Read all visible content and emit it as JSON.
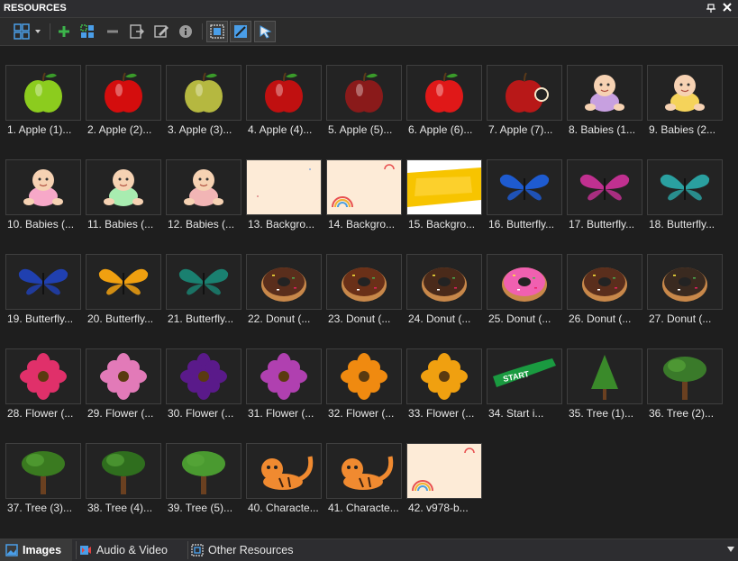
{
  "panel": {
    "title": "RESOURCES"
  },
  "toolbar": {
    "buttons": [
      "view-mode",
      "add",
      "add-multiple",
      "remove",
      "import",
      "edit",
      "info",
      "fit",
      "select-region",
      "pointer"
    ]
  },
  "items": [
    "1. Apple (1)...",
    "2. Apple (2)...",
    "3. Apple (3)...",
    "4. Apple (4)...",
    "5. Apple (5)...",
    "6. Apple (6)...",
    "7. Apple (7)...",
    "8. Babies (1...",
    "9. Babies (2...",
    "10. Babies (...",
    "11. Babies (...",
    "12. Babies (...",
    "13. Backgro...",
    "14. Backgro...",
    "15. Backgro...",
    "16. Butterfly...",
    "17. Butterfly...",
    "18. Butterfly...",
    "19. Butterfly...",
    "20. Butterfly...",
    "21. Butterfly...",
    "22. Donut (...",
    "23. Donut (...",
    "24. Donut (...",
    "25. Donut (...",
    "26. Donut (...",
    "27. Donut (...",
    "28. Flower (...",
    "29. Flower (...",
    "30. Flower (...",
    "31. Flower (...",
    "32. Flower (...",
    "33. Flower (...",
    "34. Start i...",
    "35. Tree (1)...",
    "36. Tree (2)...",
    "37. Tree (3)...",
    "38. Tree (4)...",
    "39. Tree (5)...",
    "40. Characte...",
    "41. Characte...",
    "42. v978-b..."
  ],
  "thumbnails": [
    {
      "kind": "apple",
      "color": "#8ccc1e"
    },
    {
      "kind": "apple",
      "color": "#d40d0d"
    },
    {
      "kind": "apple",
      "color": "#b5b840"
    },
    {
      "kind": "apple",
      "color": "#c01010"
    },
    {
      "kind": "apple",
      "color": "#8a1a1a"
    },
    {
      "kind": "apple",
      "color": "#e01818"
    },
    {
      "kind": "apple-bitten",
      "color": "#b81818"
    },
    {
      "kind": "baby",
      "color": "#c7a0e0"
    },
    {
      "kind": "baby",
      "color": "#f5d35a"
    },
    {
      "kind": "baby",
      "color": "#f7a8c8"
    },
    {
      "kind": "baby",
      "color": "#a8ecb0"
    },
    {
      "kind": "baby",
      "color": "#f2b5b5"
    },
    {
      "kind": "background",
      "color": "#fdebd7"
    },
    {
      "kind": "background-rainbow",
      "color": "#fdebd7"
    },
    {
      "kind": "background-yellow",
      "color": "#f7c400"
    },
    {
      "kind": "butterfly",
      "color": "#1e5bd0"
    },
    {
      "kind": "butterfly",
      "color": "#c03090"
    },
    {
      "kind": "butterfly",
      "color": "#2aa0a0"
    },
    {
      "kind": "butterfly",
      "color": "#2040b0"
    },
    {
      "kind": "butterfly",
      "color": "#f0a010"
    },
    {
      "kind": "butterfly",
      "color": "#1a8070"
    },
    {
      "kind": "donut",
      "color": "#5a2e1c"
    },
    {
      "kind": "donut",
      "color": "#6a3018"
    },
    {
      "kind": "donut",
      "color": "#4a2a1a"
    },
    {
      "kind": "donut",
      "color": "#f060b0"
    },
    {
      "kind": "donut",
      "color": "#5a2e1c"
    },
    {
      "kind": "donut",
      "color": "#3a2a20"
    },
    {
      "kind": "flower",
      "color": "#e0306a"
    },
    {
      "kind": "flower",
      "color": "#e27ab8"
    },
    {
      "kind": "flower",
      "color": "#5a1a8a"
    },
    {
      "kind": "flower",
      "color": "#b040b0"
    },
    {
      "kind": "flower",
      "color": "#f08a10"
    },
    {
      "kind": "flower",
      "color": "#f0a010"
    },
    {
      "kind": "start",
      "color": "#1a9a40"
    },
    {
      "kind": "tree-pine",
      "color": "#3a8a2a"
    },
    {
      "kind": "tree",
      "color": "#3a7a2a"
    },
    {
      "kind": "tree",
      "color": "#3a7a20"
    },
    {
      "kind": "tree",
      "color": "#2f6e1e"
    },
    {
      "kind": "tree",
      "color": "#4a9a30"
    },
    {
      "kind": "tiger",
      "color": "#f08a30"
    },
    {
      "kind": "tiger",
      "color": "#f08a30"
    },
    {
      "kind": "background-rainbow",
      "color": "#fdebd7"
    }
  ],
  "tabs": [
    {
      "label": "Images",
      "icon": "image-icon"
    },
    {
      "label": "Audio & Video",
      "icon": "media-icon"
    },
    {
      "label": "Other Resources",
      "icon": "resources-icon"
    }
  ]
}
